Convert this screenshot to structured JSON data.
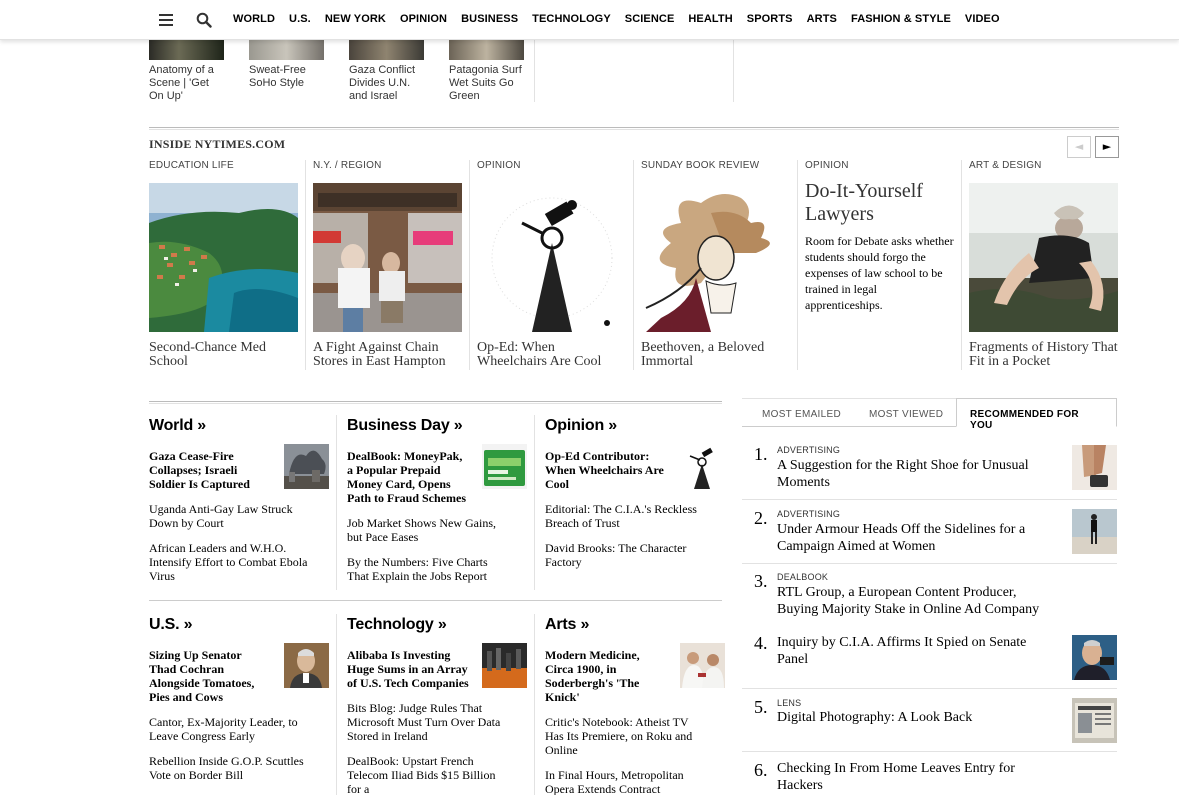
{
  "nav": {
    "items": [
      "WORLD",
      "U.S.",
      "NEW YORK",
      "OPINION",
      "BUSINESS",
      "TECHNOLOGY",
      "SCIENCE",
      "HEALTH",
      "SPORTS",
      "ARTS",
      "FASHION & STYLE",
      "VIDEO"
    ]
  },
  "strip": {
    "items": [
      {
        "caption": "Anatomy of a Scene | 'Get On Up'"
      },
      {
        "caption": "Sweat-Free SoHo Style"
      },
      {
        "caption": "Gaza Conflict Divides U.N. and Israel"
      },
      {
        "caption": "Patagonia Surf Wet Suits Go Green"
      }
    ]
  },
  "inside": {
    "title": "INSIDE NYTIMES.COM",
    "prev_arrow": "◄",
    "next_arrow": "►",
    "items": [
      {
        "kicker": "EDUCATION LIFE",
        "caption": "Second-Chance Med School"
      },
      {
        "kicker": "N.Y. / REGION",
        "caption": "A Fight Against Chain Stores in East Hampton"
      },
      {
        "kicker": "OPINION",
        "caption": "Op-Ed: When Wheelchairs Are Cool"
      },
      {
        "kicker": "SUNDAY BOOK REVIEW",
        "caption": "Beethoven, a Beloved Immortal"
      },
      {
        "kicker": "OPINION",
        "headline": "Do-It-Yourself Lawyers",
        "summary": "Room for Debate asks whether students should forgo the expenses of law school to be trained in legal apprenticeships."
      },
      {
        "kicker": "ART & DESIGN",
        "caption": "Fragments of History That Fit in a Pocket"
      }
    ]
  },
  "sections": [
    {
      "title": "World »",
      "lead": "Gaza Cease-Fire Collapses; Israeli Soldier Is Captured",
      "stories": [
        "Uganda Anti-Gay Law Struck Down by Court",
        "African Leaders and W.H.O. Intensify Effort to Combat Ebola Virus"
      ]
    },
    {
      "title": "Business Day »",
      "lead": "DealBook: MoneyPak, a Popular Prepaid Money Card, Opens Path to Fraud Schemes",
      "stories": [
        "Job Market Shows New Gains, but Pace Eases",
        "By the Numbers: Five Charts That Explain the Jobs Report"
      ]
    },
    {
      "title": "Opinion »",
      "lead": "Op-Ed Contributor: When Wheelchairs Are Cool",
      "stories": [
        "Editorial: The C.I.A.'s Reckless Breach of Trust",
        "David Brooks: The Character Factory"
      ]
    },
    {
      "title": "U.S. »",
      "lead": "Sizing Up Senator Thad Cochran Alongside Tomatoes, Pies and Cows",
      "stories": [
        "Cantor, Ex-Majority Leader, to Leave Congress Early",
        "Rebellion Inside G.O.P. Scuttles Vote on Border Bill"
      ]
    },
    {
      "title": "Technology »",
      "lead": "Alibaba Is Investing Huge Sums in an Array of U.S. Tech Companies",
      "stories": [
        "Bits Blog: Judge Rules That Microsoft Must Turn Over Data Stored in Ireland",
        "DealBook: Upstart French Telecom Iliad Bids $15 Billion for a"
      ]
    },
    {
      "title": "Arts »",
      "lead": "Modern Medicine, Circa 1900, in Soderbergh's 'The Knick'",
      "stories": [
        "Critic's Notebook: Atheist TV Has Its Premiere, on Roku and Online",
        "In Final Hours, Metropolitan Opera Extends Contract Deadlines for Unions"
      ]
    }
  ],
  "tabs": {
    "most_emailed": "MOST EMAILED",
    "most_viewed": "MOST VIEWED",
    "recommended": "RECOMMENDED FOR YOU"
  },
  "recommended": [
    {
      "num": "1.",
      "kicker": "ADVERTISING",
      "headline": "A Suggestion for the Right Shoe for Unusual Moments"
    },
    {
      "num": "2.",
      "kicker": "ADVERTISING",
      "headline": "Under Armour Heads Off the Sidelines for a Campaign Aimed at Women"
    },
    {
      "num": "3.",
      "kicker": "DEALBOOK",
      "headline": "RTL Group, a European Content Producer, Buying Majority Stake in Online Ad Company"
    },
    {
      "num": "4.",
      "kicker": "",
      "headline": "Inquiry by C.I.A. Affirms It Spied on Senate Panel"
    },
    {
      "num": "5.",
      "kicker": "LENS",
      "headline": "Digital Photography: A Look Back"
    },
    {
      "num": "6.",
      "kicker": "",
      "headline": "Checking In From Home Leaves Entry for Hackers"
    }
  ]
}
